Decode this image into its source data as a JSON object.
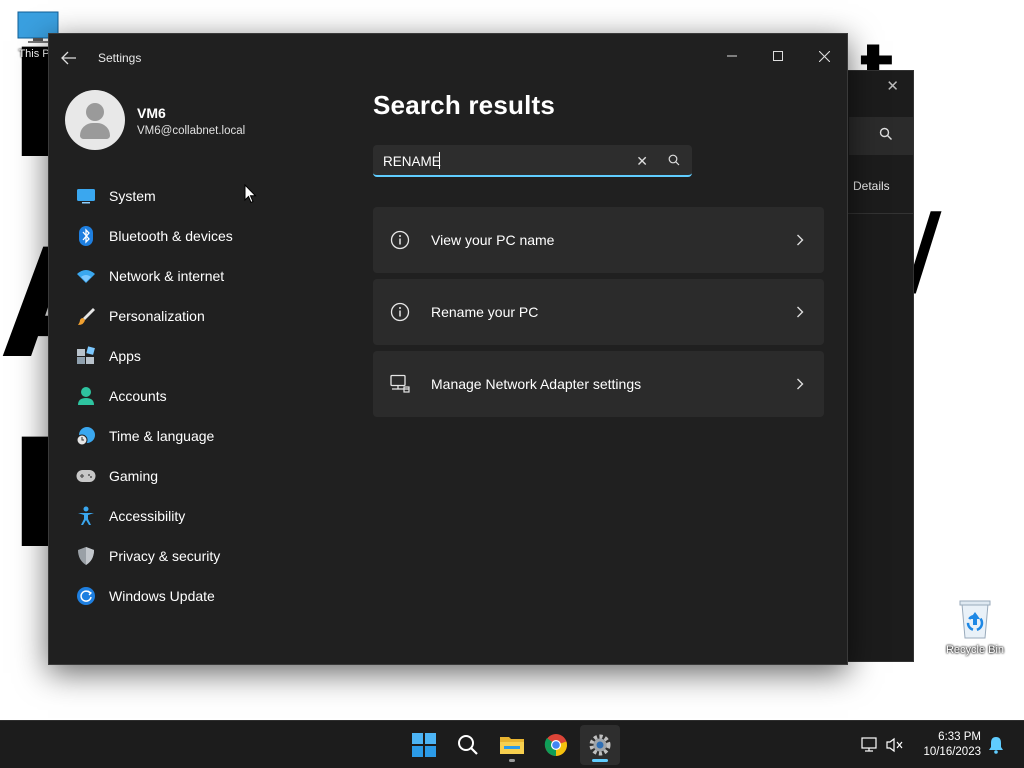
{
  "desktop": {
    "this_pc_label": "This PC",
    "recycle_bin_label": "Recycle Bin"
  },
  "background_window": {
    "details_label": "Details"
  },
  "settings": {
    "app_title": "Settings",
    "user": {
      "name": "VM6",
      "email": "VM6@collabnet.local"
    },
    "nav": [
      {
        "label": "System",
        "icon": "system-icon"
      },
      {
        "label": "Bluetooth & devices",
        "icon": "bluetooth-icon"
      },
      {
        "label": "Network & internet",
        "icon": "wifi-icon"
      },
      {
        "label": "Personalization",
        "icon": "brush-icon"
      },
      {
        "label": "Apps",
        "icon": "apps-icon"
      },
      {
        "label": "Accounts",
        "icon": "person-icon"
      },
      {
        "label": "Time & language",
        "icon": "globe-clock-icon"
      },
      {
        "label": "Gaming",
        "icon": "gamepad-icon"
      },
      {
        "label": "Accessibility",
        "icon": "accessibility-icon"
      },
      {
        "label": "Privacy & security",
        "icon": "shield-icon"
      },
      {
        "label": "Windows Update",
        "icon": "update-icon"
      }
    ],
    "page_title": "Search results",
    "search": {
      "value": "RENAME"
    },
    "results": [
      {
        "label": "View your PC name",
        "icon": "info-icon"
      },
      {
        "label": "Rename your PC",
        "icon": "info-icon"
      },
      {
        "label": "Manage Network Adapter settings",
        "icon": "network-adapter-icon"
      }
    ]
  },
  "taskbar": {
    "time": "6:33 PM",
    "date": "10/16/2023"
  },
  "colors": {
    "accent": "#60cdff",
    "window_bg": "#202020",
    "card_bg": "#2b2b2b",
    "taskbar_bg": "#1c1c1c"
  }
}
